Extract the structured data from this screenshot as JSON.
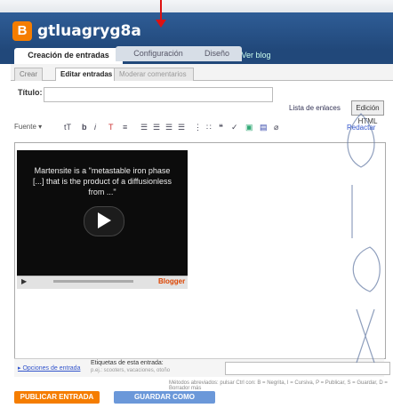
{
  "header": {
    "blog_title": "gtluagryg8a",
    "logo_letter": "B"
  },
  "tabs": [
    {
      "label": "Creación de entradas"
    },
    {
      "label": "Configuración"
    },
    {
      "label": "Diseño"
    },
    {
      "label": "Ver blog"
    }
  ],
  "subtabs": [
    {
      "label": "Crear"
    },
    {
      "label": "Editar entradas"
    },
    {
      "label": "Moderar comentarios"
    }
  ],
  "post": {
    "title_label": "Título:",
    "title_value": ""
  },
  "side": {
    "tags_link": "Lista de enlaces",
    "edit_html": "Edición HTML",
    "compose": "Redactar"
  },
  "toolbar": {
    "font": "Fuente",
    "icons": [
      "font-size-icon",
      "bold-icon",
      "italic-icon",
      "text-color-icon",
      "strikethrough-icon",
      "align-left-icon",
      "align-center-icon",
      "align-right-icon",
      "justify-icon",
      "ordered-list-icon",
      "unordered-list-icon",
      "quote-icon",
      "spellcheck-icon",
      "image-icon",
      "video-icon",
      "clear-format-icon"
    ]
  },
  "video": {
    "caption": "Martensite is a \"metastable iron phase [...] that is the product of a diffusionless from ...\"",
    "brand": "Blogger"
  },
  "footer": {
    "options_link": "Opciones de entrada",
    "labels_label": "Etiquetas de esta entrada:",
    "labels_hint": "p.ej.: scooters, vacaciones, otoño",
    "shortcuts": "Métodos abreviados: pulsar Ctrl con: B = Negrita, I = Cursiva, P = Publicar, S = Guardar, D = Borrador más"
  },
  "buttons": {
    "publish": "PUBLICAR ENTRADA",
    "save_draft": "GUARDAR COMO BORRADOR"
  },
  "colors": {
    "header": "#21487a",
    "publish": "#f57d00",
    "draft": "#6b98d9",
    "arrow": "#dd1111"
  }
}
